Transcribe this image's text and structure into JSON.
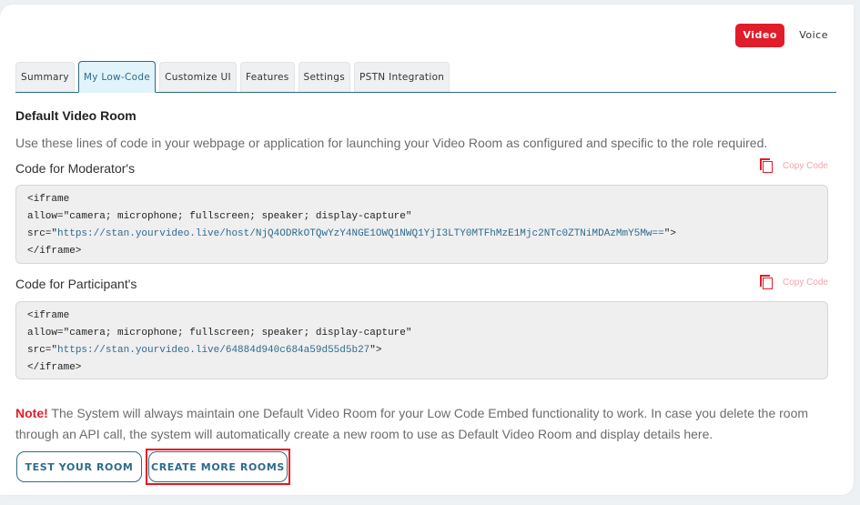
{
  "mode_switch": {
    "options": [
      {
        "label": "Video",
        "active": true
      },
      {
        "label": "Voice",
        "active": false
      }
    ],
    "active_color": "#e11d2a"
  },
  "tabs": [
    {
      "label": "Summary",
      "active": false
    },
    {
      "label": "My Low-Code",
      "active": true
    },
    {
      "label": "Customize UI",
      "active": false
    },
    {
      "label": "Features",
      "active": false
    },
    {
      "label": "Settings",
      "active": false
    },
    {
      "label": "PSTN Integration",
      "active": false
    }
  ],
  "main": {
    "title": "Default Video Room",
    "description": "Use these lines of code in your webpage or application for launching your Video Room as configured and specific to the role required.",
    "copy_label": "Copy Code",
    "moderator": {
      "label": "Code for Moderator's",
      "lines": {
        "open": "<iframe",
        "allow": "allow=\"camera; microphone; fullscreen; speaker; display-capture\"",
        "src_prefix": "src=\"",
        "src_url": "https://stan.yourvideo.live/host/NjQ4ODRkOTQwYzY4NGE1OWQ1NWQ1YjI3LTY0MTFhMzE1Mjc2NTc0ZTNiMDAzMmY5Mw==",
        "src_suffix": "\">",
        "close": "</iframe>"
      }
    },
    "participant": {
      "label": "Code for Participant's",
      "lines": {
        "open": "<iframe",
        "allow": "allow=\"camera; microphone; fullscreen; speaker; display-capture\"",
        "src_prefix": "src=\"",
        "src_url": "https://stan.yourvideo.live/64884d940c684a59d55d5b27",
        "src_suffix": "\">",
        "close": "</iframe>"
      }
    },
    "note": {
      "tag": "Note!",
      "text": " The System will always maintain one Default Video Room for your Low Code Embed functionality to work. In case you delete the room through an API call, the system will automatically create a new room to use as Default Video Room and display details here."
    }
  },
  "actions": {
    "test_room": "TEST YOUR ROOM",
    "create_rooms": "CREATE MORE ROOMS"
  }
}
